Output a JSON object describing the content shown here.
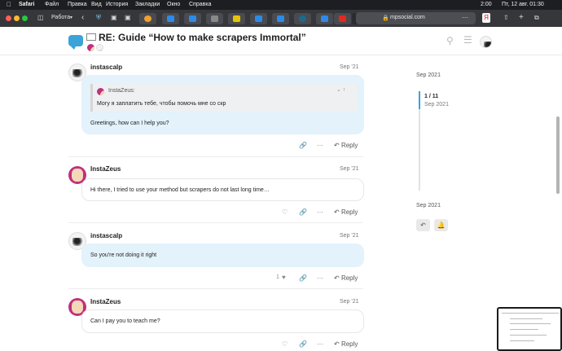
{
  "menubar": {
    "app": "Safari",
    "items": [
      "Файл",
      "Правка",
      "Вид",
      "История",
      "Закладки",
      "Окно",
      "Справка"
    ],
    "clock": "Пт, 12 авг. 01:30",
    "time_small": "2:00"
  },
  "browser": {
    "tab_group": "Работа",
    "url": "mpsocial.com",
    "traffic_lights": [
      "#ff5f57",
      "#febc2e",
      "#28c840"
    ]
  },
  "topic": {
    "title": "RE: Guide “How to make scrapers Immortal”"
  },
  "posts": [
    {
      "username": "instascalp",
      "date": "Sep '21",
      "quote": {
        "author": "InstaZeus:",
        "text": "Могу я заплатить тебе, чтобы помочь мне со скр"
      },
      "text": "Greetings, how can I help you?",
      "reply": "Reply",
      "likes": ""
    },
    {
      "username": "InstaZeus",
      "date": "Sep '21",
      "text": "Hi there, I tried to use your method but scrapers do not last long time…",
      "reply": "Reply",
      "likes": ""
    },
    {
      "username": "instascalp",
      "date": "Sep '21",
      "text": "So you're not doing it right",
      "reply": "Reply",
      "likes": "1"
    },
    {
      "username": "InstaZeus",
      "date": "Sep '21",
      "text": "Can I pay you to teach me?",
      "reply": "Reply",
      "likes": ""
    }
  ],
  "timeline": {
    "top_date": "Sep 2021",
    "position": "1 / 11",
    "position_date": "Sep 2021",
    "bottom_date": "Sep 2021"
  },
  "colors": {
    "accent": "#3aa3d8",
    "bubble_blue": "#e3f2fb"
  }
}
